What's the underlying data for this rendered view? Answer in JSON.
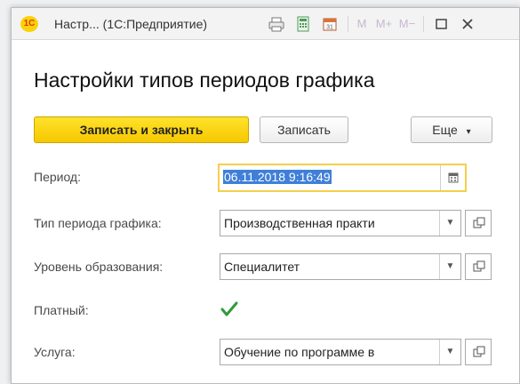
{
  "window": {
    "title": "Настр... (1С:Предприятие)",
    "logo_text": "1С",
    "toolbar": {
      "print_icon": "printer-icon",
      "calc_icon": "calculator-icon",
      "calendar_icon": "calendar-icon",
      "m_label": "M",
      "mplus_label": "M+",
      "mminus_label": "M−",
      "maximize_icon": "maximize-icon",
      "close_icon": "close-icon"
    }
  },
  "form": {
    "heading": "Настройки типов периодов графика",
    "buttons": {
      "save_close": "Записать и закрыть",
      "save": "Записать",
      "more": "Еще"
    },
    "fields": {
      "period": {
        "label": "Период:",
        "value": "06.11.2018  9:16:49"
      },
      "schedule_period_type": {
        "label": "Тип периода графика:",
        "value": "Производственная практи"
      },
      "education_level": {
        "label": "Уровень образования:",
        "value": "Специалитет"
      },
      "paid": {
        "label": "Платный:",
        "checked": true
      },
      "service": {
        "label": "Услуга:",
        "value": "Обучение по программе в"
      }
    }
  },
  "colors": {
    "primary_button": "#f6c800",
    "focus_border": "#f4cf4a",
    "selection": "#3f7fd8",
    "checkmark": "#2e9a3a"
  }
}
